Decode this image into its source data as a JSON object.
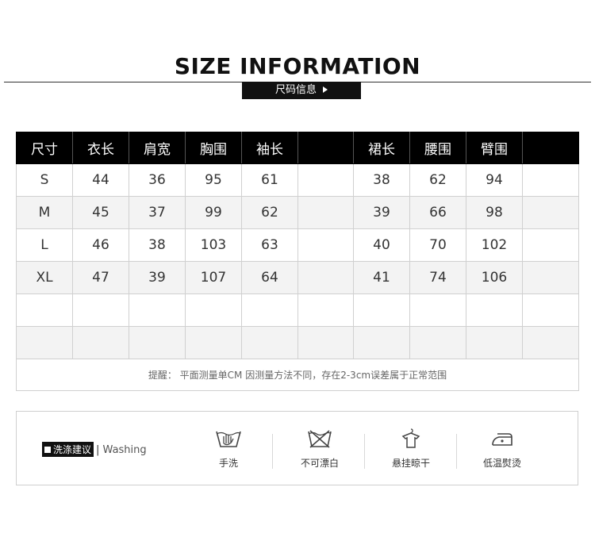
{
  "header": {
    "title": "SIZE INFORMATION",
    "subtitle": "尺码信息"
  },
  "size_table": {
    "columns": [
      "尺寸",
      "衣长",
      "肩宽",
      "胸围",
      "袖长",
      "",
      "裙长",
      "腰围",
      "臂围",
      ""
    ],
    "rows": [
      [
        "S",
        "44",
        "36",
        "95",
        "61",
        "",
        "38",
        "62",
        "94",
        ""
      ],
      [
        "M",
        "45",
        "37",
        "99",
        "62",
        "",
        "39",
        "66",
        "98",
        ""
      ],
      [
        "L",
        "46",
        "38",
        "103",
        "63",
        "",
        "40",
        "70",
        "102",
        ""
      ],
      [
        "XL",
        "47",
        "39",
        "107",
        "64",
        "",
        "41",
        "74",
        "106",
        ""
      ],
      [
        "",
        "",
        "",
        "",
        "",
        "",
        "",
        "",
        "",
        ""
      ],
      [
        "",
        "",
        "",
        "",
        "",
        "",
        "",
        "",
        "",
        ""
      ]
    ],
    "note": "提醒： 平面测量单CM 因测量方法不同，存在2-3cm误差属于正常范围"
  },
  "care": {
    "label_cn": "洗涤建议",
    "label_sep": "|",
    "label_en": "Washing",
    "items": [
      {
        "icon": "hand-wash-icon",
        "label": "手洗"
      },
      {
        "icon": "no-bleach-icon",
        "label": "不可漂白"
      },
      {
        "icon": "hang-dry-icon",
        "label": "悬挂晾干"
      },
      {
        "icon": "low-iron-icon",
        "label": "低温熨烫"
      }
    ]
  }
}
